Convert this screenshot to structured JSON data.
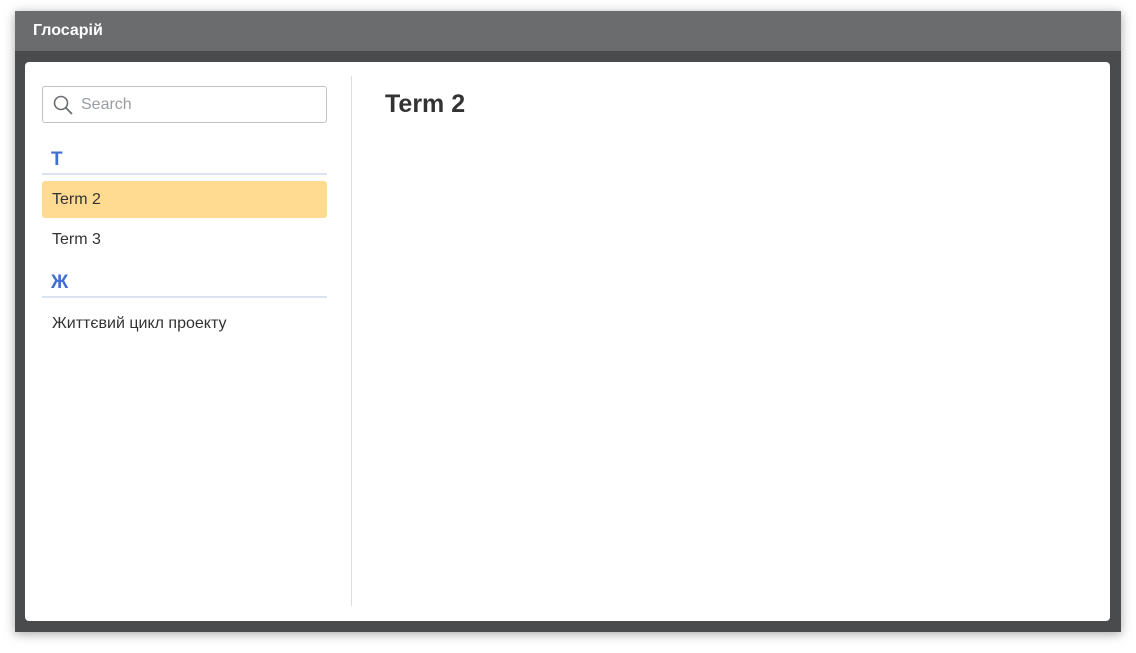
{
  "window": {
    "title": "Глосарій"
  },
  "search": {
    "placeholder": "Search",
    "icon": "search-icon"
  },
  "sidebar": {
    "groups": [
      {
        "letter": "T",
        "items": [
          {
            "label": "Term 2",
            "selected": true
          },
          {
            "label": "Term 3",
            "selected": false
          }
        ]
      },
      {
        "letter": "Ж",
        "items": [
          {
            "label": "Життєвий цикл проекту",
            "selected": false
          }
        ]
      }
    ]
  },
  "main": {
    "title": "Term 2"
  },
  "colors": {
    "titlebar": "#6a6c6e",
    "frame": "#4a4b4d",
    "accent_letter": "#3f6fd1",
    "selected_item": "#ffda91"
  }
}
